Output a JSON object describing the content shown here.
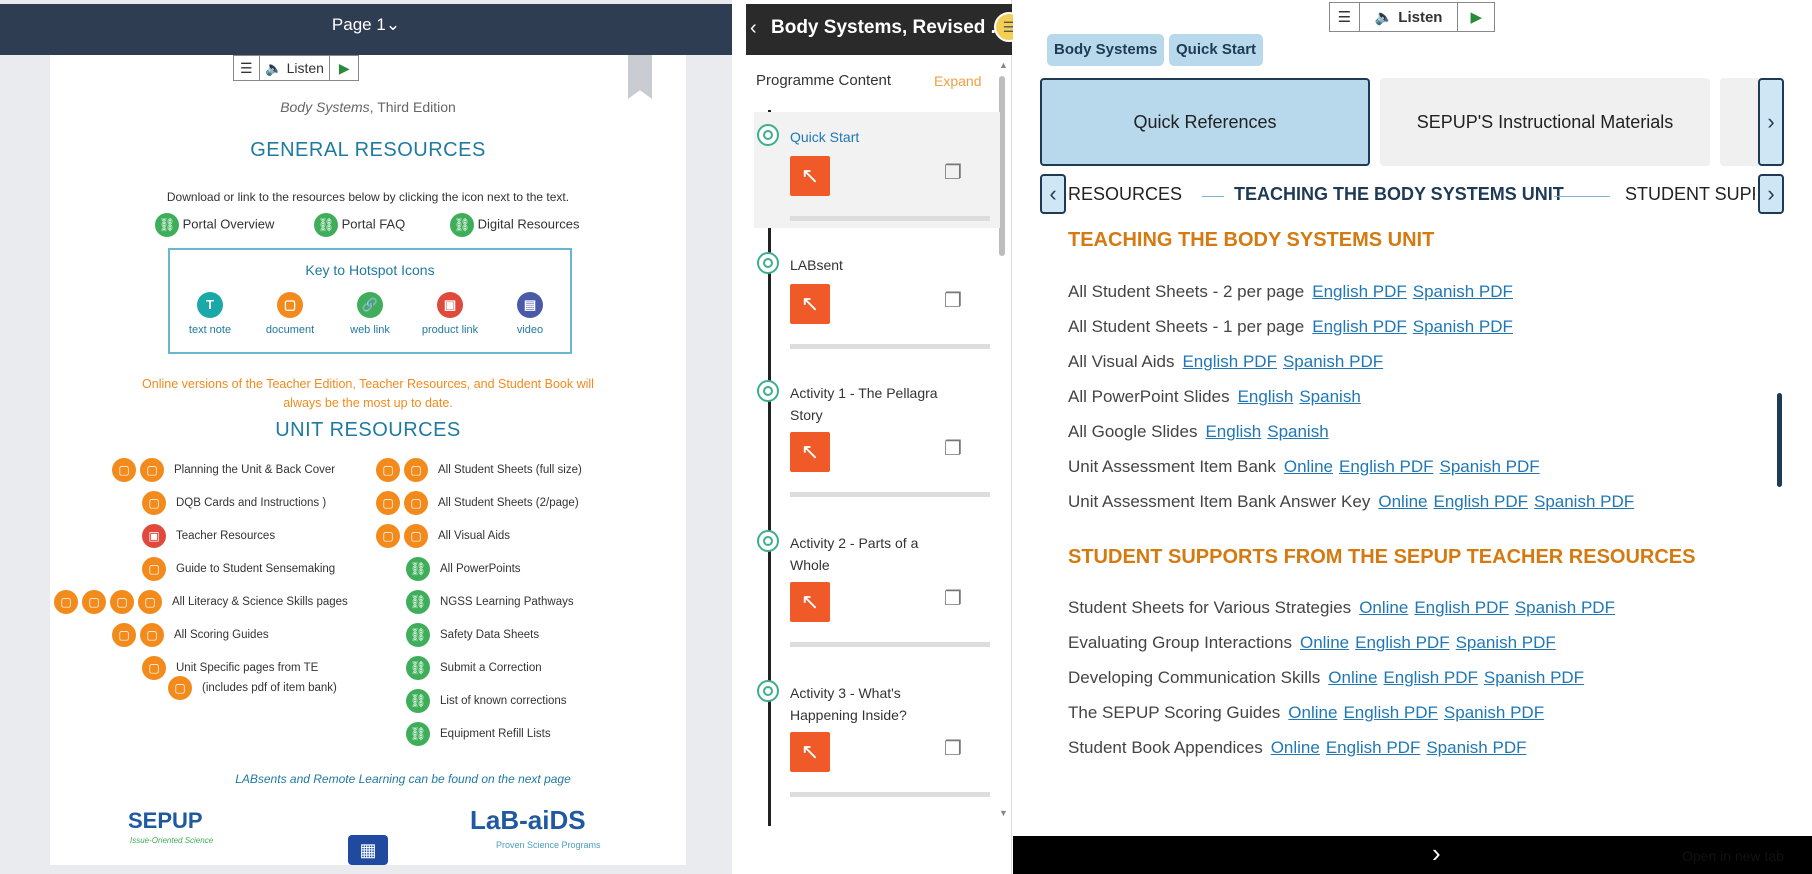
{
  "left": {
    "page_label": "Page 1",
    "page_caret": "⌄",
    "listen_label": "Listen",
    "subtitle_italic": "Body Systems",
    "subtitle_rest": ", Third Edition",
    "general_heading": "GENERAL RESOURCES",
    "download_text": "Download or link to the resources below by clicking the icon next to the text.",
    "general_links": [
      "Portal Overview",
      "Portal FAQ",
      "Digital Resources"
    ],
    "key_heading": "Key to Hotspot Icons",
    "key_items": [
      "text note",
      "document",
      "web link",
      "product link",
      "video"
    ],
    "key_glyphs": [
      "T",
      "▢",
      "🔗",
      "▣",
      "▤"
    ],
    "online_note": "Online versions of the Teacher Edition, Teacher Resources, and Student Book will always be the most up to date.",
    "unit_heading": "UNIT RESOURCES",
    "unit_left": [
      "Planning the Unit & Back Cover",
      "DQB Cards and Instructions )",
      "Teacher Resources",
      "Guide to Student Sensemaking",
      "All Literacy & Science Skills pages",
      "All Scoring Guides",
      "Unit Specific pages from TE",
      "(includes pdf of item bank)"
    ],
    "unit_right": [
      "All Student Sheets (full size)",
      "All Student Sheets (2/page)",
      "All Visual Aids",
      "All PowerPoints",
      "NGSS Learning Pathways",
      "Safety Data Sheets",
      "Submit a Correction",
      "List of known corrections",
      "Equipment Refill Lists"
    ],
    "labsent_note": "LABsents and Remote Learning can be found on the next page",
    "logo_sepup": "SEPUP",
    "logo_sepup_sub": "Issue-Oriented Science",
    "logo_lab": "LaB-aiDS",
    "logo_lab_sub": "Proven Science Programs"
  },
  "mid": {
    "title": "Body Systems, Revised ...",
    "programme_label": "Programme Content",
    "expand_label": "Expand",
    "activities": [
      "Quick Start",
      "LABsent",
      "Activity 1 - The Pellagra Story",
      "Activity 2 - Parts of a Whole",
      "Activity 3 - What's Happening Inside?"
    ]
  },
  "right": {
    "listen_label": "Listen",
    "chips": [
      "Body Systems",
      "Quick Start"
    ],
    "tabs": [
      "Quick References",
      "SEPUP'S Instructional Materials"
    ],
    "strip": [
      "RESOURCES",
      "TEACHING THE BODY SYSTEMS UNIT",
      "STUDENT SUPPO"
    ],
    "section1_heading": "TEACHING THE BODY SYSTEMS UNIT",
    "section1_rows": [
      {
        "label": "All Student Sheets - 2 per page",
        "links": [
          "English PDF",
          "Spanish PDF"
        ]
      },
      {
        "label": "All Student Sheets - 1 per page",
        "links": [
          "English PDF",
          "Spanish PDF"
        ]
      },
      {
        "label": "All Visual Aids",
        "links": [
          "English PDF",
          "Spanish PDF"
        ]
      },
      {
        "label": "All PowerPoint Slides",
        "links": [
          "English",
          "Spanish"
        ]
      },
      {
        "label": "All Google Slides",
        "links": [
          "English",
          "Spanish"
        ]
      },
      {
        "label": "Unit Assessment Item Bank",
        "links": [
          "Online",
          "English PDF",
          "Spanish PDF"
        ]
      },
      {
        "label": "Unit Assessment Item Bank Answer Key",
        "links": [
          "Online",
          "English PDF",
          "Spanish PDF"
        ]
      }
    ],
    "section2_heading": "STUDENT SUPPORTS FROM THE SEPUP TEACHER RESOURCES",
    "section2_rows": [
      {
        "label": "Student Sheets for Various Strategies",
        "links": [
          "Online",
          "English PDF",
          "Spanish PDF"
        ]
      },
      {
        "label": "Evaluating Group Interactions",
        "links": [
          "Online",
          "English PDF",
          "Spanish PDF"
        ]
      },
      {
        "label": "Developing Communication Skills",
        "links": [
          "Online",
          "English PDF",
          "Spanish PDF"
        ]
      },
      {
        "label": "The SEPUP Scoring Guides",
        "links": [
          "Online",
          "English PDF",
          "Spanish PDF"
        ]
      },
      {
        "label": "Student Book Appendices",
        "links": [
          "Online",
          "English PDF",
          "Spanish PDF"
        ]
      }
    ],
    "open_new_tab": "Open in new tab"
  },
  "colors": {
    "accent": "#1f7aa0",
    "orange": "#f28a1c",
    "link_green": "#3fae5a",
    "heading_orange": "#d47a10",
    "chip_blue": "#b8d8ec"
  }
}
